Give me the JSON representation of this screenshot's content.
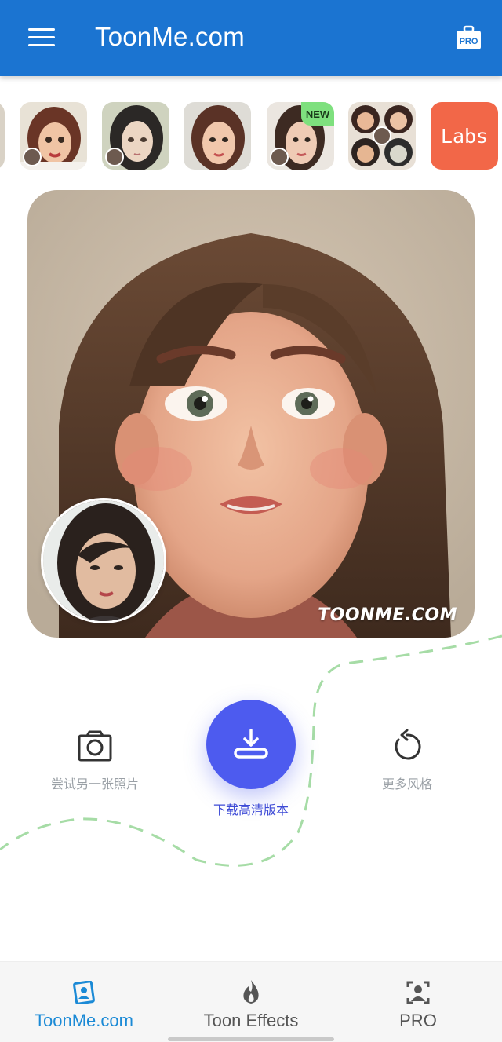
{
  "header": {
    "title": "ToonMe.com",
    "pro_badge": "PRO"
  },
  "styles": {
    "new_badge": "NEW",
    "labs_label": "Labs"
  },
  "result": {
    "watermark": "TOONME.COM"
  },
  "actions": {
    "try_another": "尝试另一张照片",
    "download": "下载高清版本",
    "more_styles": "更多风格"
  },
  "bottom_nav": {
    "items": [
      {
        "label": "ToonMe.com",
        "active": true,
        "color": "#1b8ad6"
      },
      {
        "label": "Toon Effects",
        "active": false,
        "color": "#555555"
      },
      {
        "label": "PRO",
        "active": false,
        "color": "#555555"
      }
    ]
  },
  "colors": {
    "header": "#1b74d1",
    "download_button": "#4d5bef",
    "labs_tile": "#f26748",
    "new_badge": "#7ee07e",
    "dashed_path": "#a6dca6"
  }
}
